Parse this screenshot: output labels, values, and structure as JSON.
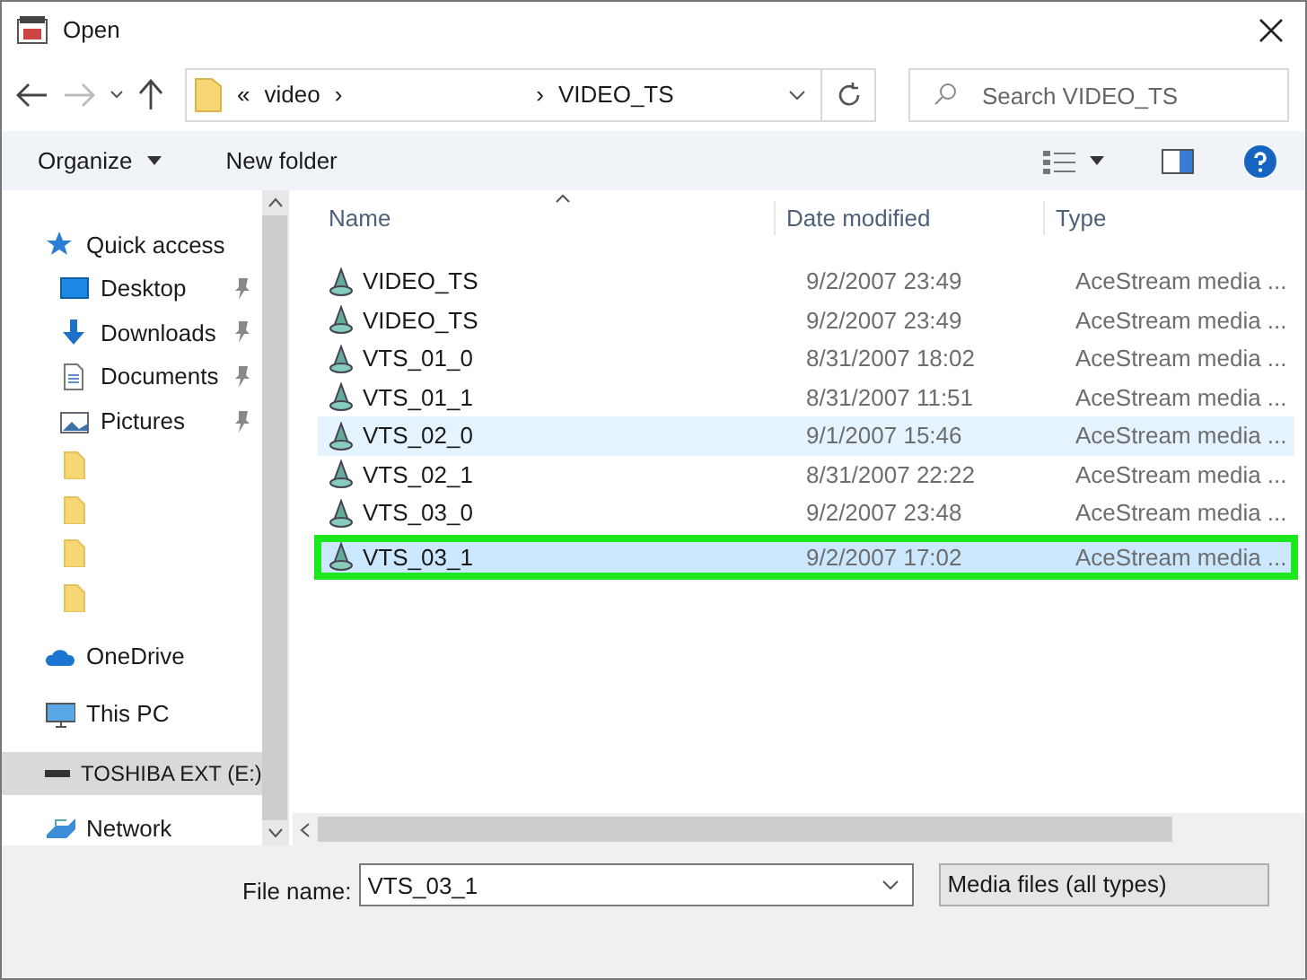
{
  "window": {
    "title": "Open"
  },
  "address_bar": {
    "segments": [
      "«",
      "video",
      "›",
      "›",
      "VIDEO_TS"
    ]
  },
  "search": {
    "placeholder": "Search VIDEO_TS"
  },
  "toolbar": {
    "organize": "Organize",
    "new_folder": "New folder"
  },
  "sidebar": {
    "items": [
      {
        "kind": "star",
        "label": "Quick access",
        "pinned": false,
        "selected": false
      },
      {
        "kind": "desktop",
        "label": "Desktop",
        "pinned": true,
        "selected": false
      },
      {
        "kind": "downloads",
        "label": "Downloads",
        "pinned": true,
        "selected": false
      },
      {
        "kind": "documents",
        "label": "Documents",
        "pinned": true,
        "selected": false
      },
      {
        "kind": "pictures",
        "label": "Pictures",
        "pinned": true,
        "selected": false
      },
      {
        "kind": "folder",
        "pinned": false,
        "selected": false
      },
      {
        "kind": "folder",
        "pinned": false,
        "selected": false
      },
      {
        "kind": "folder",
        "pinned": false,
        "selected": false
      },
      {
        "kind": "folder",
        "pinned": false,
        "selected": false
      },
      {
        "kind": "cloud",
        "label": "OneDrive",
        "pinned": false,
        "selected": false
      },
      {
        "kind": "pc",
        "label": "This PC",
        "pinned": false,
        "selected": false
      },
      {
        "kind": "drive",
        "label": "TOSHIBA EXT (E:)",
        "pinned": false,
        "selected": true
      },
      {
        "kind": "network",
        "label": "Network",
        "pinned": false,
        "selected": false
      }
    ]
  },
  "table": {
    "columns": [
      "Name",
      "Date modified",
      "Type"
    ],
    "rows": [
      {
        "name": "VIDEO_TS",
        "date": "9/2/2007 23:49",
        "type": "AceStream media ...",
        "hovered": false,
        "selected": false
      },
      {
        "name": "VIDEO_TS",
        "date": "9/2/2007 23:49",
        "type": "AceStream media ...",
        "hovered": false,
        "selected": false
      },
      {
        "name": "VTS_01_0",
        "date": "8/31/2007 18:02",
        "type": "AceStream media ...",
        "hovered": false,
        "selected": false
      },
      {
        "name": "VTS_01_1",
        "date": "8/31/2007 11:51",
        "type": "AceStream media ...",
        "hovered": false,
        "selected": false
      },
      {
        "name": "VTS_02_0",
        "date": "9/1/2007 15:46",
        "type": "AceStream media ...",
        "hovered": true,
        "selected": false
      },
      {
        "name": "VTS_02_1",
        "date": "8/31/2007 22:22",
        "type": "AceStream media ...",
        "hovered": false,
        "selected": false
      },
      {
        "name": "VTS_03_0",
        "date": "9/2/2007 23:48",
        "type": "AceStream media ...",
        "hovered": false,
        "selected": false
      },
      {
        "name": "VTS_03_1",
        "date": "9/2/2007 17:02",
        "type": "AceStream media ...",
        "hovered": false,
        "selected": true
      }
    ]
  },
  "footer": {
    "file_name_label": "File name:",
    "file_name": "VTS_03_1",
    "file_type": "Media files (all types)"
  }
}
